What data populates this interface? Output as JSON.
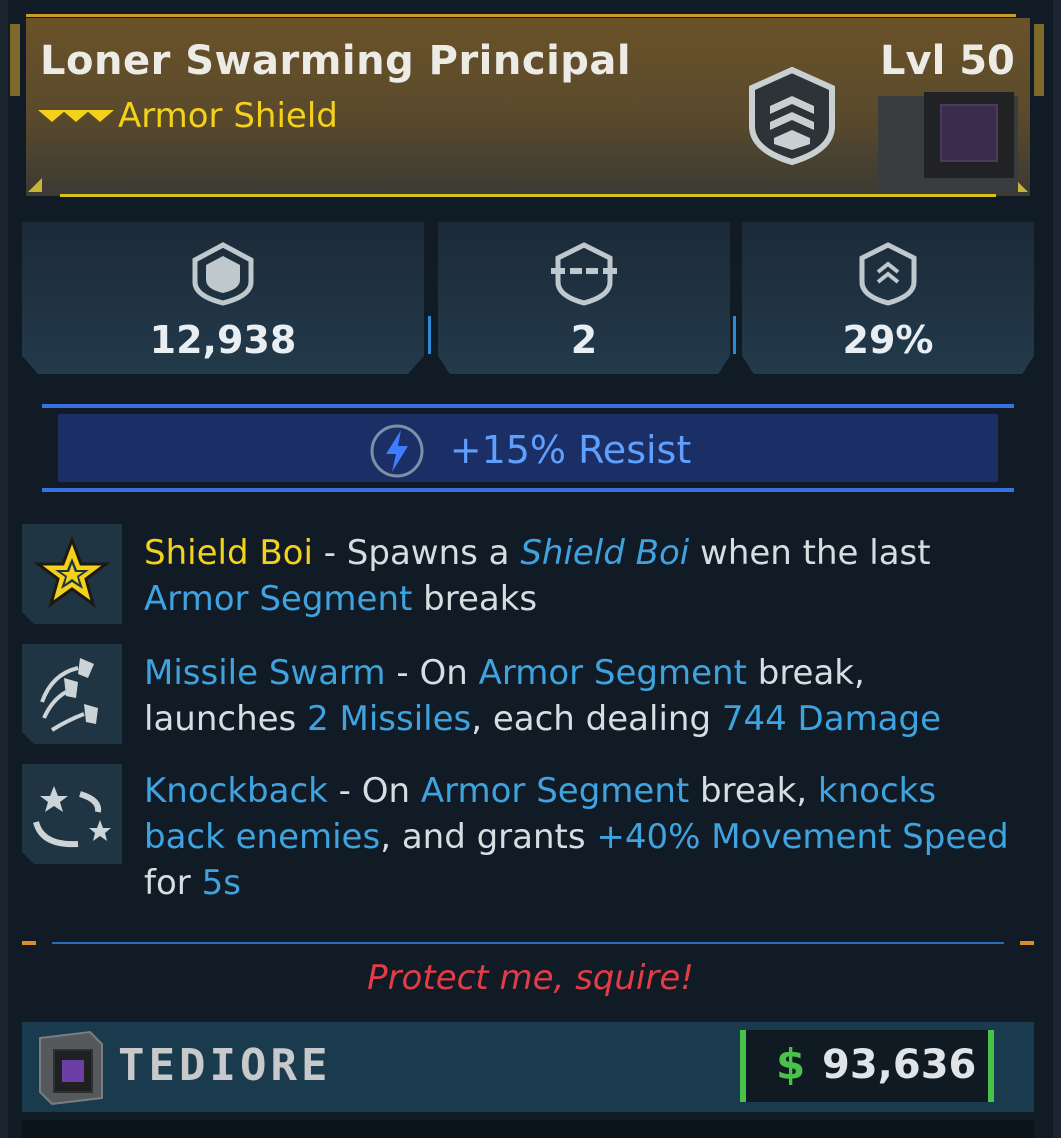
{
  "item": {
    "name": "Loner Swarming Principal",
    "type": "Armor Shield",
    "level": "Lvl 50",
    "rarity_color": "#f4d11a"
  },
  "stats": [
    {
      "icon": "shield-capacity-icon",
      "value": "12,938"
    },
    {
      "icon": "armor-segment-icon",
      "value": "2"
    },
    {
      "icon": "recharge-icon",
      "value": "29%"
    }
  ],
  "resist": {
    "icon": "lightning-icon",
    "label": "+15% Resist"
  },
  "perks": [
    {
      "icon": "star-badge-icon",
      "name": "Shield Boi",
      "parts": [
        " - Spawns a ",
        "Shield Boi",
        " when the last ",
        "Armor Segment",
        " breaks"
      ]
    },
    {
      "icon": "missile-swarm-icon",
      "name": "Missile Swarm",
      "parts": [
        " - On ",
        "Armor Segment",
        " break, launches ",
        "2 Missiles",
        ", each dealing ",
        "744 Damage"
      ]
    },
    {
      "icon": "knockback-stars-icon",
      "name": "Knockback",
      "parts": [
        " - On ",
        "Armor Segment",
        " break, ",
        "knocks back enemies",
        ", and grants ",
        "+40% Movement Speed",
        " for ",
        "5s"
      ]
    }
  ],
  "flavor_text": "Protect me, squire!",
  "manufacturer": "TEDIORE",
  "price": {
    "currency_symbol": "$",
    "value": "93,636"
  },
  "colors": {
    "accent_blue": "#3fa3e0",
    "flavor_red": "#e23c46",
    "price_green": "#49c24a"
  }
}
